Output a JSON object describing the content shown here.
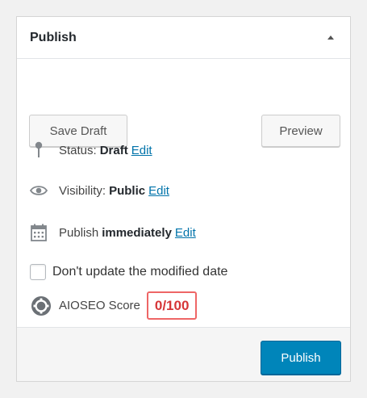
{
  "panel": {
    "title": "Publish"
  },
  "actions": {
    "save_draft_label": "Save Draft",
    "preview_label": "Preview",
    "publish_label": "Publish"
  },
  "status": {
    "label": "Status:",
    "value": "Draft",
    "edit_label": "Edit",
    "icon": "pin-icon"
  },
  "visibility": {
    "label": "Visibility:",
    "value": "Public",
    "edit_label": "Edit",
    "icon": "eye-icon"
  },
  "schedule": {
    "label": "Publish",
    "value": "immediately",
    "edit_label": "Edit",
    "icon": "calendar-icon"
  },
  "modified_date": {
    "label": "Don't update the modified date",
    "checked": false
  },
  "aioseo": {
    "label": "AIOSEO Score",
    "score": "0/100",
    "icon": "aioseo-gear-icon"
  },
  "colors": {
    "primary_button": "#0085ba",
    "link": "#0073aa",
    "score_bad": "#d63638"
  }
}
